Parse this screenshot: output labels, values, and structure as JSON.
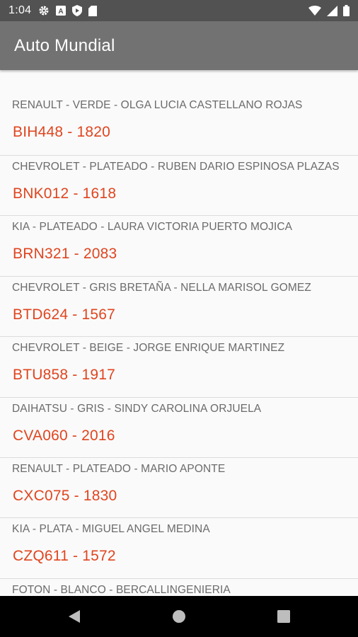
{
  "status_bar": {
    "time": "1:04",
    "left_icons": [
      "gear-icon",
      "a-badge-icon",
      "play-shield-icon",
      "sd-card-icon"
    ],
    "right_icons": [
      "wifi-icon",
      "signal-icon",
      "battery-icon"
    ]
  },
  "app_bar": {
    "title": "Auto Mundial",
    "color": "#727272"
  },
  "colors": {
    "accent": "#e0451f",
    "subtitle": "#6b6b6b"
  },
  "list": {
    "items": [
      {
        "subtitle": "RENAULT - VERDE - OLGA LUCIA CASTELLANO ROJAS",
        "title": "BIH448 - 1820"
      },
      {
        "subtitle": "CHEVROLET - PLATEADO - RUBEN DARIO ESPINOSA PLAZAS",
        "title": "BNK012 - 1618"
      },
      {
        "subtitle": "KIA - PLATEADO - LAURA VICTORIA PUERTO MOJICA",
        "title": "BRN321 - 2083"
      },
      {
        "subtitle": "CHEVROLET - GRIS BRETAÑA - NELLA MARISOL GOMEZ",
        "title": "BTD624 - 1567"
      },
      {
        "subtitle": "CHEVROLET - BEIGE - JORGE ENRIQUE MARTINEZ",
        "title": "BTU858 - 1917"
      },
      {
        "subtitle": "DAIHATSU - GRIS - SINDY CAROLINA ORJUELA",
        "title": "CVA060 - 2016"
      },
      {
        "subtitle": "RENAULT - PLATEADO - MARIO APONTE",
        "title": "CXC075 - 1830"
      },
      {
        "subtitle": "KIA - PLATA - MIGUEL ANGEL MEDINA",
        "title": "CZQ611 - 1572"
      },
      {
        "subtitle": "FOTON - BLANCO - BERCALLINGENIERIA",
        "title": ""
      }
    ]
  },
  "nav_bar": {
    "buttons": [
      "back-icon",
      "home-icon",
      "recents-icon"
    ]
  }
}
